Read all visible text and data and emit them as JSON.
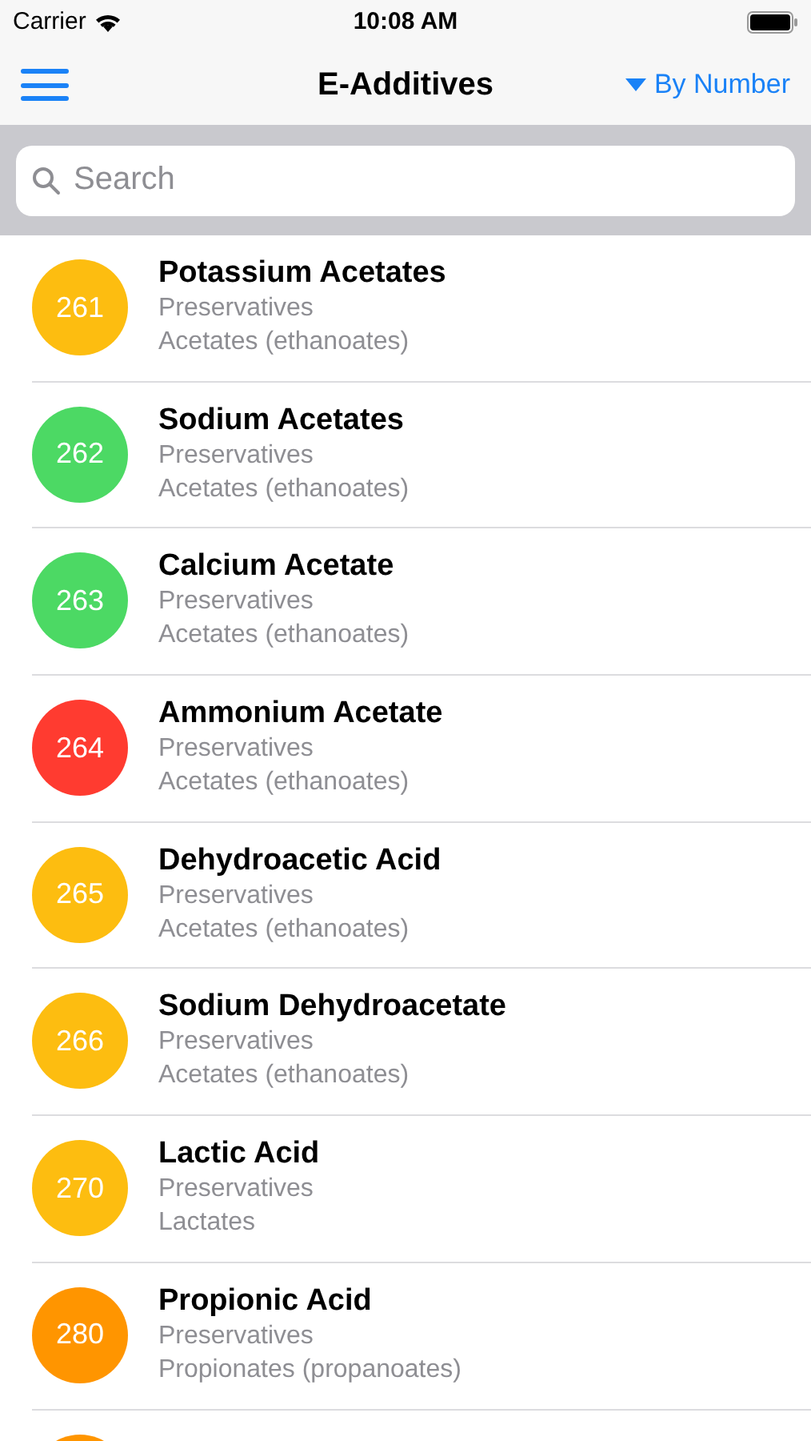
{
  "status_bar": {
    "carrier": "Carrier",
    "time": "10:08 AM"
  },
  "nav": {
    "title": "E-Additives",
    "sort": "By Number"
  },
  "search": {
    "placeholder": "Search"
  },
  "items": [
    {
      "number": "261",
      "name": "Potassium Acetates",
      "category": "Preservatives",
      "group": "Acetates (ethanoates)",
      "color": "#fdbd10"
    },
    {
      "number": "262",
      "name": "Sodium Acetates",
      "category": "Preservatives",
      "group": "Acetates (ethanoates)",
      "color": "#4cd964"
    },
    {
      "number": "263",
      "name": "Calcium Acetate",
      "category": "Preservatives",
      "group": "Acetates (ethanoates)",
      "color": "#4cd964"
    },
    {
      "number": "264",
      "name": "Ammonium Acetate",
      "category": "Preservatives",
      "group": "Acetates (ethanoates)",
      "color": "#ff3b30"
    },
    {
      "number": "265",
      "name": "Dehydroacetic Acid",
      "category": "Preservatives",
      "group": "Acetates (ethanoates)",
      "color": "#fdbd10"
    },
    {
      "number": "266",
      "name": "Sodium Dehydroacetate",
      "category": "Preservatives",
      "group": "Acetates (ethanoates)",
      "color": "#fdbd10"
    },
    {
      "number": "270",
      "name": "Lactic Acid",
      "category": "Preservatives",
      "group": "Lactates",
      "color": "#fdbd10"
    },
    {
      "number": "280",
      "name": "Propionic Acid",
      "category": "Preservatives",
      "group": "Propionates (propanoates)",
      "color": "#ff9500"
    },
    {
      "color": "#ff9500"
    }
  ]
}
